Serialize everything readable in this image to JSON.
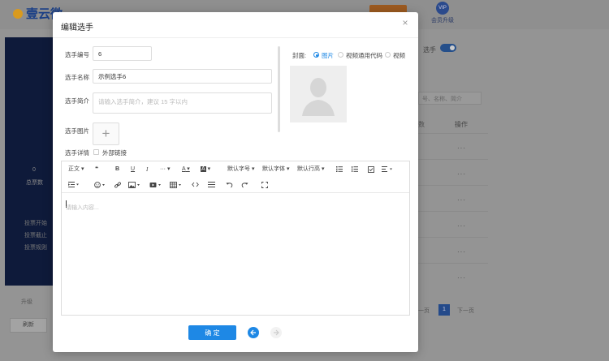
{
  "background": {
    "logo_text": "壹云微",
    "vip_label": "会员升级",
    "vip_badge": "VIP",
    "right_toggle_label": "选手",
    "right_column_header_action": "操作",
    "right_column_header_extra": "数",
    "search_placeholder": "号、名称、简介",
    "pager": {
      "prev": "一页",
      "current": "1",
      "next": "下一页"
    },
    "refresh_button": "刷新",
    "panel_count": "0",
    "panel_count_label": "总票数",
    "panel_items": [
      "投票开始",
      "投票截止",
      "投票规则"
    ],
    "panel_bottom_label": "升级"
  },
  "modal": {
    "title": "编辑选手",
    "close_glyph": "×",
    "fields": {
      "number_label": "选手编号",
      "number_value": "6",
      "name_label": "选手名称",
      "name_value": "示例选手6",
      "intro_label": "选手简介",
      "intro_placeholder": "请输入选手简介，建议 15 字以内",
      "image_label": "选手图片",
      "image_add": "+",
      "detail_label": "选手详情",
      "external_link_label": "外部链接"
    },
    "cover": {
      "label": "封面:",
      "options": [
        "图片",
        "视频通用代码",
        "视频"
      ],
      "selected": "图片"
    },
    "editor": {
      "toolbar_row1": {
        "paragraph": "正文",
        "quote": "❝",
        "bold": "B",
        "underline": "U",
        "italic": "I",
        "more": "···",
        "font_color": "A",
        "bg_color": "A",
        "font_size": "默认字号",
        "font_family": "默认字体",
        "line_height": "默认行高"
      },
      "placeholder": "请输入内容..."
    },
    "confirm_button": "确 定"
  }
}
